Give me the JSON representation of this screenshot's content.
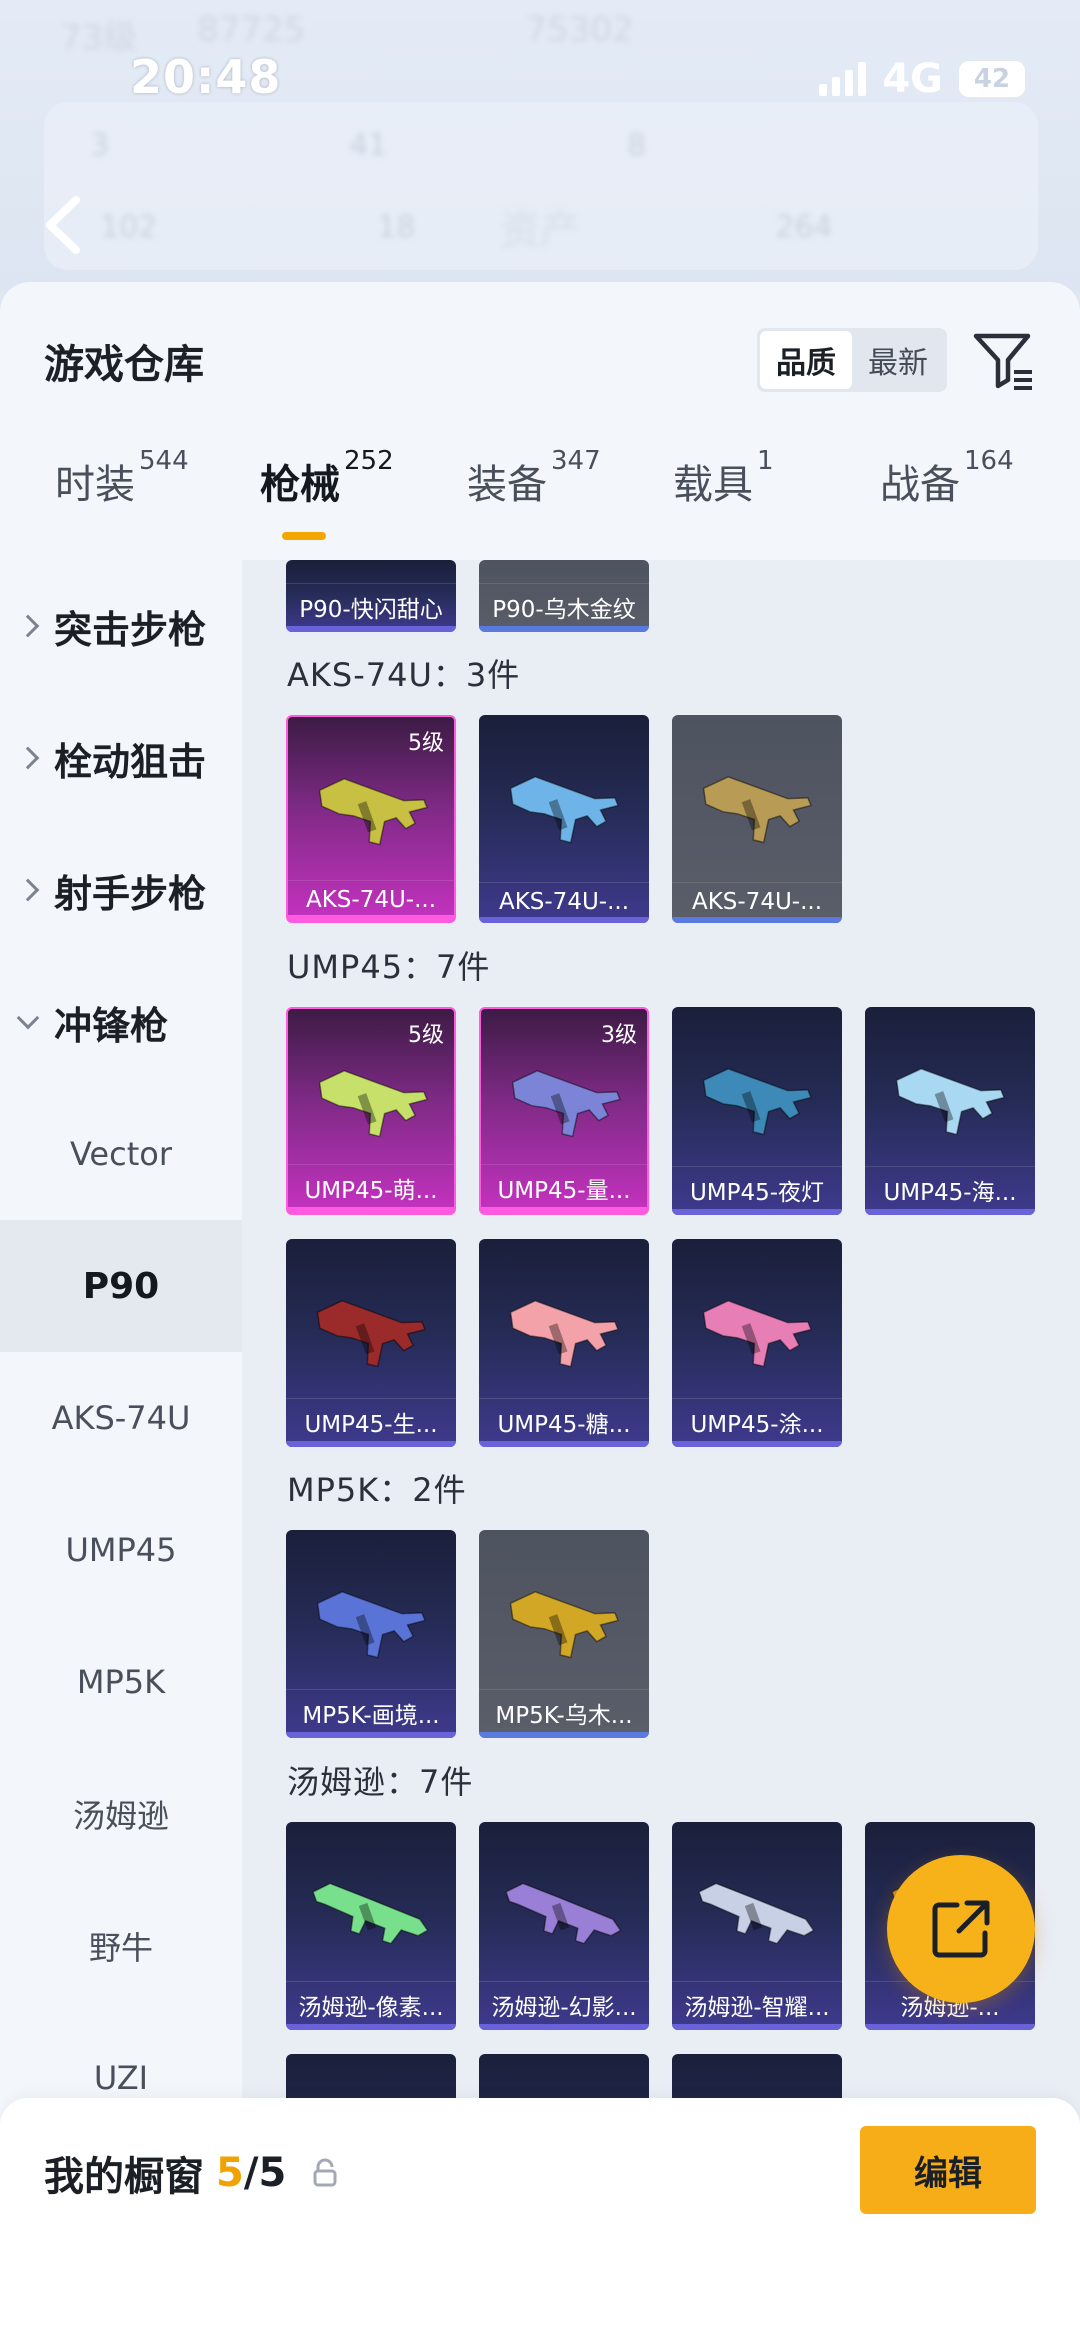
{
  "status_bar": {
    "time": "20:48",
    "network": "4G",
    "battery": "42"
  },
  "background_header": {
    "top_items": [
      "73级",
      "87725",
      "75302"
    ],
    "row1": [
      "3",
      "41",
      "8"
    ],
    "row2": [
      "102",
      "18",
      "264"
    ],
    "title": "资产"
  },
  "header": {
    "title": "游戏仓库",
    "sort_options": [
      {
        "label": "品质",
        "active": true
      },
      {
        "label": "最新",
        "active": false
      }
    ]
  },
  "tabs": [
    {
      "label": "时装",
      "count": "544",
      "active": false
    },
    {
      "label": "枪械",
      "count": "252",
      "active": true
    },
    {
      "label": "装备",
      "count": "347",
      "active": false
    },
    {
      "label": "载具",
      "count": "1",
      "active": false
    },
    {
      "label": "战备",
      "count": "164",
      "active": false
    }
  ],
  "sidebar": {
    "categories": [
      {
        "label": "突击步枪",
        "open": false
      },
      {
        "label": "栓动狙击",
        "open": false
      },
      {
        "label": "射手步枪",
        "open": false
      },
      {
        "label": "冲锋枪",
        "open": true
      }
    ],
    "subitems": [
      {
        "label": "Vector",
        "active": false
      },
      {
        "label": "P90",
        "active": true
      },
      {
        "label": "AKS-74U",
        "active": false
      },
      {
        "label": "UMP45",
        "active": false
      },
      {
        "label": "MP5K",
        "active": false
      },
      {
        "label": "汤姆逊",
        "active": false
      },
      {
        "label": "野牛",
        "active": false
      },
      {
        "label": "UZI",
        "active": false
      }
    ]
  },
  "groups": [
    {
      "title": "",
      "items": [
        {
          "name": "P90-快闪甜心",
          "rarity": "purple"
        },
        {
          "name": "P90-乌木金纹",
          "rarity": "gray"
        }
      ]
    },
    {
      "title": "AKS-74U：3件",
      "items": [
        {
          "name": "AKS-74U-...",
          "rarity": "pink",
          "level": "5级",
          "gun_color": "#c8c043"
        },
        {
          "name": "AKS-74U-...",
          "rarity": "purple",
          "gun_color": "#6fb4e8"
        },
        {
          "name": "AKS-74U-...",
          "rarity": "gray",
          "gun_color": "#b89b55"
        }
      ]
    },
    {
      "title": "UMP45：7件",
      "items": [
        {
          "name": "UMP45-萌...",
          "rarity": "pink",
          "level": "5级",
          "gun_color": "#c7e06a"
        },
        {
          "name": "UMP45-量...",
          "rarity": "pink",
          "level": "3级",
          "gun_color": "#7c84d8"
        },
        {
          "name": "UMP45-夜灯",
          "rarity": "purple",
          "gun_color": "#3d8ab8"
        },
        {
          "name": "UMP45-海...",
          "rarity": "purple",
          "gun_color": "#a9d8f2"
        },
        {
          "name": "UMP45-生...",
          "rarity": "purple",
          "gun_color": "#9b2b2b"
        },
        {
          "name": "UMP45-糖...",
          "rarity": "purple",
          "gun_color": "#f2a2a8"
        },
        {
          "name": "UMP45-涂...",
          "rarity": "purple",
          "gun_color": "#e77fb6"
        }
      ]
    },
    {
      "title": "MP5K：2件",
      "items": [
        {
          "name": "MP5K-画境...",
          "rarity": "purple",
          "gun_color": "#5a73d6"
        },
        {
          "name": "MP5K-乌木...",
          "rarity": "gray",
          "gun_color": "#d2a726"
        }
      ]
    },
    {
      "title": "汤姆逊：7件",
      "items": [
        {
          "name": "汤姆逊-像素...",
          "rarity": "purple",
          "gun_color": "#78e08c"
        },
        {
          "name": "汤姆逊-幻影...",
          "rarity": "purple",
          "gun_color": "#9a7fd6"
        },
        {
          "name": "汤姆逊-智耀...",
          "rarity": "purple",
          "gun_color": "#c8d0e6"
        },
        {
          "name": "汤姆逊-...",
          "rarity": "purple",
          "gun_color": "#c58b2d"
        }
      ]
    }
  ],
  "bottom_bar": {
    "label": "我的橱窗",
    "count": "5",
    "separator": "/",
    "total": "5",
    "edit_label": "编辑"
  },
  "colors": {
    "accent": "#f7ad17",
    "pink_rarity": "#ff5ae0",
    "purple_rarity": "#6a62d8",
    "gray_rarity": "#5b7ae0"
  }
}
